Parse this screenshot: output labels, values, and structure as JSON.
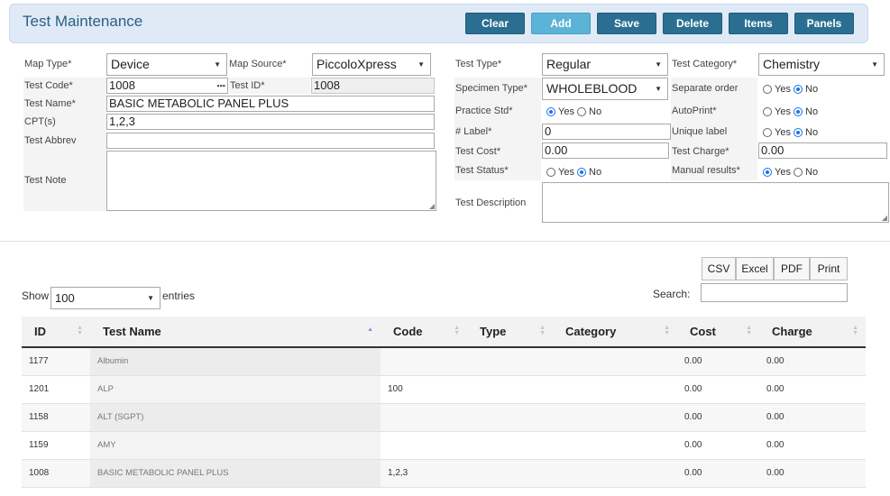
{
  "header": {
    "title": "Test Maintenance",
    "buttons": {
      "clear": "Clear",
      "add": "Add",
      "save": "Save",
      "delete": "Delete",
      "items": "Items",
      "panels": "Panels"
    }
  },
  "left": {
    "map_type": {
      "label": "Map Type*",
      "value": "Device"
    },
    "map_source": {
      "label": "Map Source*",
      "value": "PiccoloXpress"
    },
    "test_code": {
      "label": "Test Code*",
      "value": "1008"
    },
    "test_id": {
      "label": "Test ID*",
      "value": "1008"
    },
    "test_name": {
      "label": "Test Name*",
      "value": "BASIC METABOLIC  PANEL PLUS"
    },
    "cpt": {
      "label": "CPT(s)",
      "value": "1,2,3"
    },
    "test_abbrev": {
      "label": "Test Abbrev",
      "value": ""
    },
    "test_note": {
      "label": "Test Note",
      "value": ""
    }
  },
  "right": {
    "test_type": {
      "label": "Test Type*",
      "value": "Regular"
    },
    "test_category": {
      "label": "Test Category*",
      "value": "Chemistry"
    },
    "specimen_type": {
      "label": "Specimen Type*",
      "value": "WHOLEBLOOD"
    },
    "separate_order": {
      "label": "Separate order",
      "yes": "Yes",
      "no": "No",
      "selected": "No"
    },
    "practice_std": {
      "label": "Practice Std*",
      "yes": "Yes",
      "no": "No",
      "selected": "Yes"
    },
    "autoprint": {
      "label": "AutoPrint*",
      "yes": "Yes",
      "no": "No",
      "selected": "No"
    },
    "num_label": {
      "label": "# Label*",
      "value": "0"
    },
    "unique_label": {
      "label": "Unique label",
      "yes": "Yes",
      "no": "No",
      "selected": "No"
    },
    "test_cost": {
      "label": "Test Cost*",
      "value": "0.00"
    },
    "test_charge": {
      "label": "Test Charge*",
      "value": "0.00"
    },
    "test_status": {
      "label": "Test Status*",
      "yes": "Yes",
      "no": "No",
      "selected": "No"
    },
    "manual_results": {
      "label": "Manual results*",
      "yes": "Yes",
      "no": "No",
      "selected": "Yes"
    },
    "test_description": {
      "label": "Test Description",
      "value": ""
    }
  },
  "export": {
    "csv": "CSV",
    "excel": "Excel",
    "pdf": "PDF",
    "print": "Print"
  },
  "list_controls": {
    "show": "Show",
    "entries": "entries",
    "page_size": "100",
    "search_label": "Search:",
    "search_value": ""
  },
  "table": {
    "columns": [
      "ID",
      "Test Name",
      "Code",
      "Type",
      "Category",
      "Cost",
      "Charge"
    ],
    "sorted_column": "Test Name",
    "rows": [
      {
        "id": "1177",
        "name": "Albumin",
        "code": "",
        "type": "",
        "category": "",
        "cost": "0.00",
        "charge": "0.00"
      },
      {
        "id": "1201",
        "name": "ALP",
        "code": "100",
        "type": "",
        "category": "",
        "cost": "0.00",
        "charge": "0.00"
      },
      {
        "id": "1158",
        "name": "ALT (SGPT)",
        "code": "",
        "type": "",
        "category": "",
        "cost": "0.00",
        "charge": "0.00"
      },
      {
        "id": "1159",
        "name": "AMY",
        "code": "",
        "type": "",
        "category": "",
        "cost": "0.00",
        "charge": "0.00"
      },
      {
        "id": "1008",
        "name": "BASIC METABOLIC PANEL PLUS",
        "code": "1,2,3",
        "type": "",
        "category": "",
        "cost": "0.00",
        "charge": "0.00"
      }
    ]
  }
}
